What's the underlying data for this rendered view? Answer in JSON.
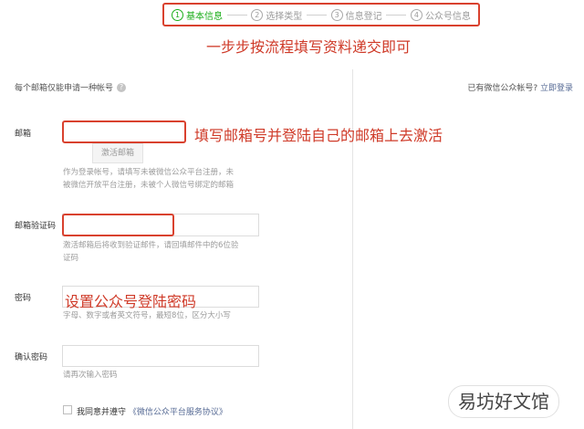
{
  "steps": [
    {
      "num": "1",
      "label": "基本信息",
      "active": true
    },
    {
      "num": "2",
      "label": "选择类型"
    },
    {
      "num": "3",
      "label": "信息登记"
    },
    {
      "num": "4",
      "label": "公众号信息"
    }
  ],
  "annotations": {
    "flow": "一步步按流程填写资料递交即可",
    "email": "填写邮箱号并登陆自己的邮箱上去激活",
    "password": "设置公众号登陆密码"
  },
  "header": {
    "hint": "每个邮箱仅能申请一种帐号",
    "help_icon": "?",
    "login_prompt": "已有微信公众帐号?",
    "login_link": "立即登录"
  },
  "form": {
    "email_label": "邮箱",
    "activate_button": "激活邮箱",
    "email_tip_1": "作为登录帐号，请填写未被微信公众平台注册，未",
    "email_tip_2": "被微信开放平台注册，未被个人微信号绑定的邮箱",
    "code_label": "邮箱验证码",
    "code_tip_1": "激活邮箱后将收到验证邮件，请回填邮件中的6位验",
    "code_tip_2": "证码",
    "password_label": "密码",
    "password_tip": "字母、数字或者英文符号，最短8位，区分大小写",
    "confirm_label": "确认密码",
    "confirm_tip": "请再次输入密码",
    "agree_text": "我同意并遵守",
    "agree_link": "《微信公众平台服务协议》"
  },
  "watermark": "易坊好文馆",
  "colors": {
    "annotation_red": "#cf3a28",
    "active_step": "#1aad19",
    "link": "#576b95"
  }
}
